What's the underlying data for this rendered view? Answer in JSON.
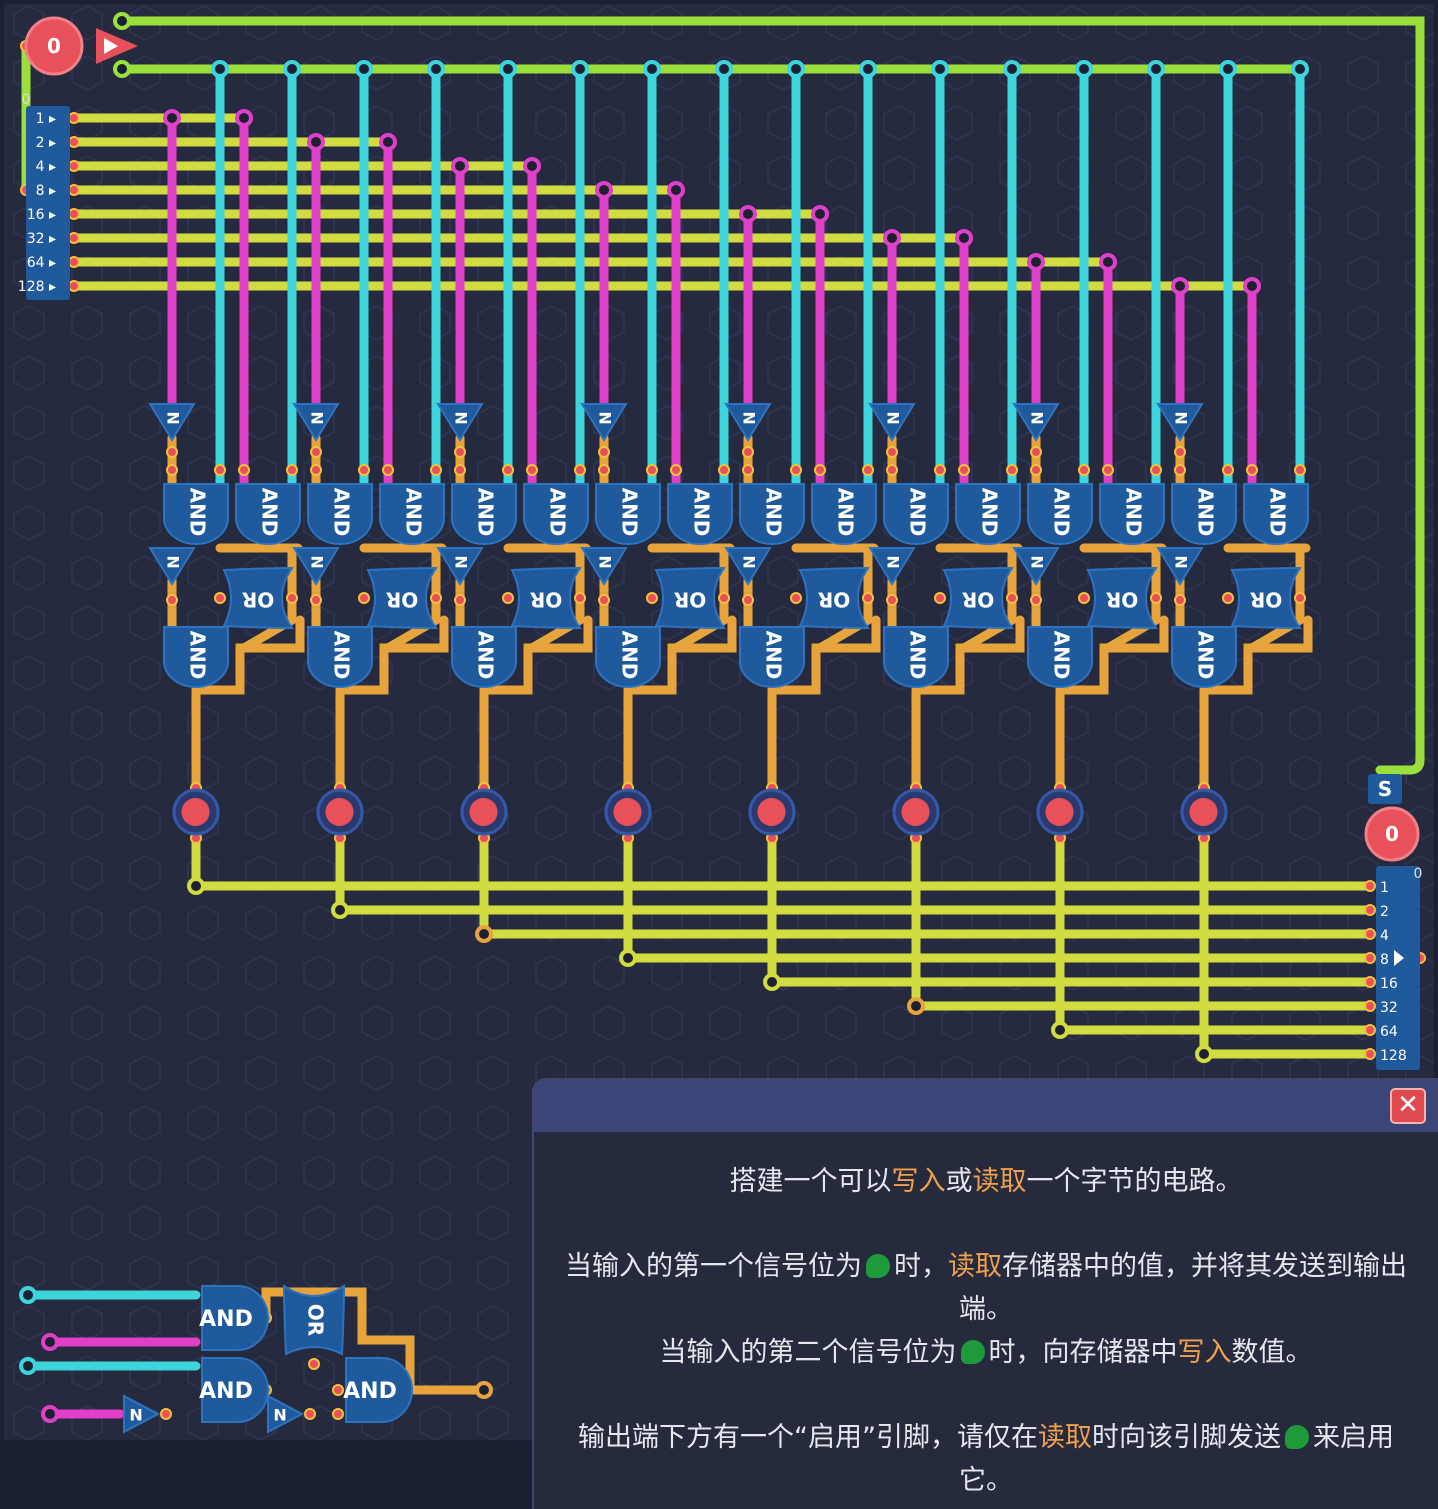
{
  "input_switch": {
    "value": "0",
    "state_label": "0"
  },
  "input_byte": {
    "bits": [
      "1",
      "2",
      "4",
      "8",
      "16",
      "32",
      "64",
      "128"
    ]
  },
  "output_byte": {
    "bits": [
      "1",
      "2",
      "4",
      "8",
      "16",
      "32",
      "64",
      "128"
    ],
    "enable_label": "S",
    "value": "0",
    "state_label": "0"
  },
  "gates": {
    "and": "AND",
    "or": "OR",
    "not": "N"
  },
  "dialog": {
    "line1": {
      "before": "搭建一个可以",
      "write": "写入",
      "mid": "或",
      "read": "读取",
      "after": "一个字节的电路。"
    },
    "line2": {
      "before": "当输入的第一个信号位为",
      "mid": "时，",
      "read": "读取",
      "after": "存储器中的值，并将其发送到输出端。"
    },
    "line3": {
      "before": "当输入的第二个信号位为",
      "mid": "时，向存储器中",
      "write": "写入",
      "after": "数值。"
    },
    "line4": {
      "before": "输出端下方有一个“启用”引脚，请仅在",
      "read": "读取",
      "mid": "时向该引脚发送",
      "after": "来启用它。"
    },
    "close_icon": "close-icon",
    "signal_icon": "green-signal-icon"
  },
  "colors": {
    "cyan": "#3ed4dc",
    "magenta": "#e040c8",
    "yellow": "#d0dc40",
    "lime": "#9ae03c",
    "orange": "#e8a43c",
    "gate": "#1f5a9c",
    "pin": "#e8505a",
    "background": "#23283d"
  }
}
